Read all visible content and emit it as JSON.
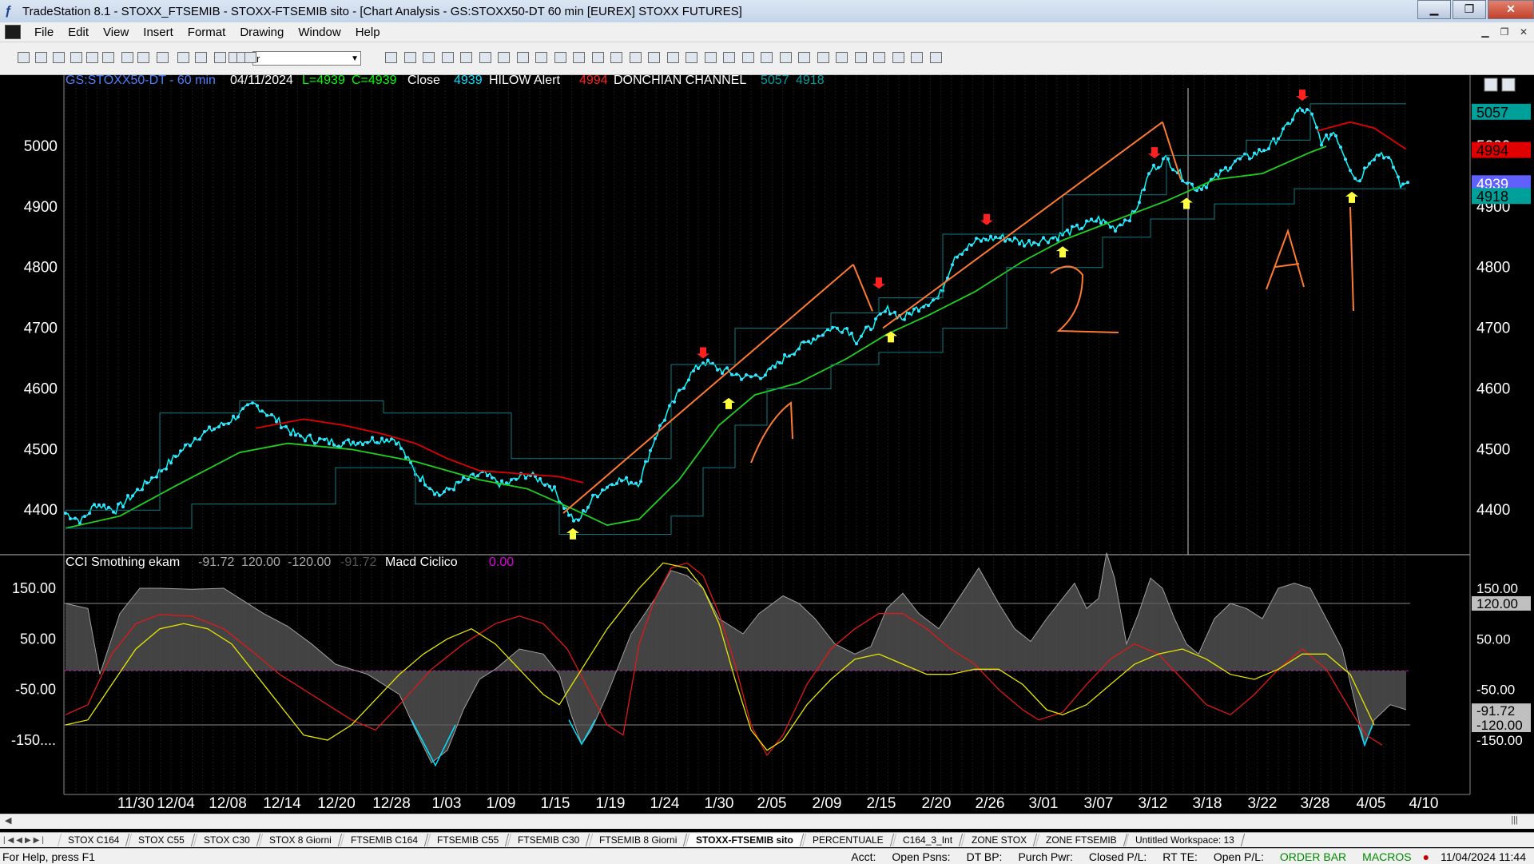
{
  "window": {
    "title": "TradeStation 8.1 - STOXX_FTSEMIB - STOXX-FTSEMIB sito - [Chart Analysis - GS:STOXX50-DT  60 min  [EUREX] STOXX FUTURES]"
  },
  "menu": [
    "File",
    "Edit",
    "View",
    "Insert",
    "Format",
    "Drawing",
    "Window",
    "Help"
  ],
  "toolbar": {
    "symbol_value": "r"
  },
  "chart": {
    "header": {
      "symbol": "GS:STOXX50-DT - 60 min",
      "date": "04/11/2024",
      "low": "L=4939",
      "close": "C=4939",
      "close_label": "Close",
      "close_value": "4939",
      "hilow": "HILOW Alert",
      "hilow_value": "4994",
      "donchian": "DONCHIAN CHANNEL",
      "donchian_upper": "5057",
      "donchian_lower": "4918"
    },
    "price_axis": [
      "5000",
      "4900",
      "4800",
      "4700",
      "4600",
      "4500",
      "4400"
    ],
    "price_badges": [
      {
        "value": "5057",
        "bg": "#00a09a",
        "fg": "#000000"
      },
      {
        "value": "4994",
        "bg": "#e00000",
        "fg": "#000000"
      },
      {
        "value": "4939",
        "bg": "#6060ff",
        "fg": "#ffffff"
      },
      {
        "value": "4918",
        "bg": "#00a09a",
        "fg": "#000000"
      }
    ],
    "annotations": [
      "1",
      "2",
      "A",
      "1"
    ],
    "indicator_header": {
      "name": "CCI Smothing ekam",
      "v1": "-91.72",
      "v2": "120.00",
      "v3": "-120.00",
      "v4": "-91.72",
      "macd": "Macd Ciclico",
      "macd_value": "0.00"
    },
    "osc_axis": [
      "150.00",
      "50.00",
      "-50.00",
      "-150...."
    ],
    "osc_badges": [
      {
        "value": "150.00",
        "bg": "#000000",
        "fg": "#ffffff"
      },
      {
        "value": "120.00",
        "bg": "#c0c0c0",
        "fg": "#000000"
      },
      {
        "value": "50.00",
        "bg": "#000000",
        "fg": "#ffffff"
      },
      {
        "value": "-50.00",
        "bg": "#000000",
        "fg": "#ffffff"
      },
      {
        "value": "-91.72",
        "bg": "#c0c0c0",
        "fg": "#000000"
      },
      {
        "value": "-120.00",
        "bg": "#c0c0c0",
        "fg": "#000000"
      },
      {
        "value": "-150.00",
        "bg": "#000000",
        "fg": "#ffffff"
      }
    ],
    "date_axis": [
      "11/30",
      "12/04",
      "12/08",
      "12/14",
      "12/20",
      "12/28",
      "1/03",
      "1/09",
      "1/15",
      "1/19",
      "1/24",
      "1/30",
      "2/05",
      "2/09",
      "2/15",
      "2/20",
      "2/26",
      "3/01",
      "3/07",
      "3/12",
      "3/18",
      "3/22",
      "3/28",
      "4/05",
      "4/10"
    ]
  },
  "workspace_tabs": [
    {
      "label": "STOX C164",
      "active": false
    },
    {
      "label": "STOX C55",
      "active": false
    },
    {
      "label": "STOX  C30",
      "active": false
    },
    {
      "label": "STOX  8 Giorni",
      "active": false
    },
    {
      "label": "FTSEMIB C164",
      "active": false
    },
    {
      "label": "FTSEMIB C55",
      "active": false
    },
    {
      "label": "FTSEMIB C30",
      "active": false
    },
    {
      "label": "FTSEMIB  8 Giorni",
      "active": false
    },
    {
      "label": "STOXX-FTSEMIB sito",
      "active": true
    },
    {
      "label": "PERCENTUALE",
      "active": false
    },
    {
      "label": "C164_3_Int",
      "active": false
    },
    {
      "label": "ZONE STOX",
      "active": false
    },
    {
      "label": "ZONE FTSEMIB",
      "active": false
    },
    {
      "label": "Untitled Workspace:  13",
      "active": false
    }
  ],
  "status": {
    "help": "For Help, press F1",
    "acct": "Acct:",
    "open_psns": "Open Psns:",
    "dt_bp": "DT BP:",
    "purch_pwr": "Purch Pwr:",
    "closed_pl": "Closed P/L:",
    "rt_te": "RT TE:",
    "open_pl": "Open P/L:",
    "order_bar": "ORDER BAR",
    "macros": "MACROS",
    "datetime": "11/04/2024 11:44"
  }
}
